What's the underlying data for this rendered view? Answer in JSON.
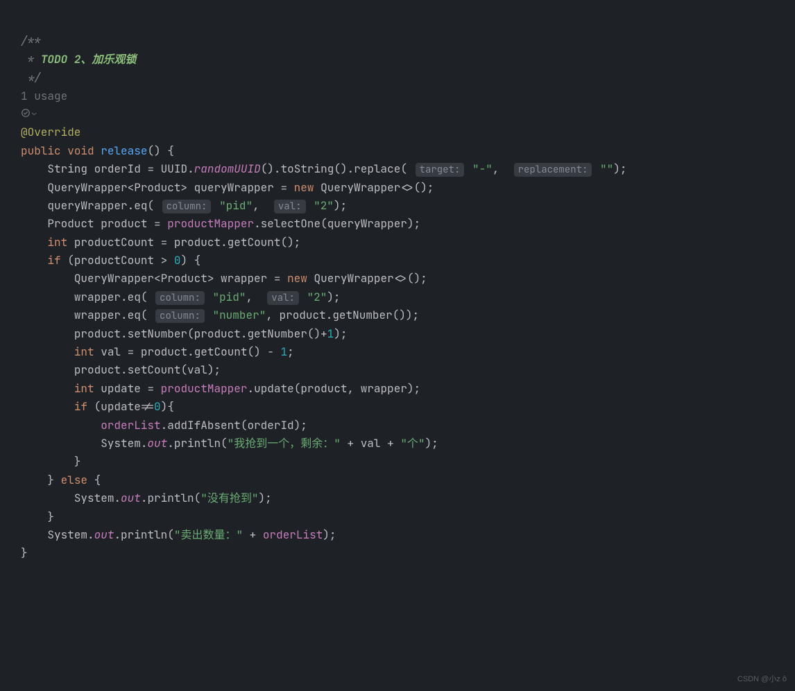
{
  "comment": {
    "open": "/**",
    "star": " * ",
    "todo": "TODO 2、加乐观锁",
    "close": " */"
  },
  "hints": {
    "usage": "1 usage",
    "target": "target:",
    "replacement": "replacement:",
    "column": "column:",
    "val": "val:"
  },
  "code": {
    "annotation": "@Override",
    "kw_public": "public",
    "kw_void": "void",
    "method_name": "release",
    "kw_new": "new",
    "kw_int": "int",
    "kw_if": "if",
    "kw_else": "else",
    "type_String": "String",
    "type_QueryWrapper": "QueryWrapper",
    "type_Product": "Product",
    "var_orderId": "orderId",
    "var_queryWrapper": "queryWrapper",
    "var_product": "product",
    "var_productCount": "productCount",
    "var_wrapper": "wrapper",
    "var_val": "val",
    "var_update": "update",
    "class_UUID": "UUID",
    "m_randomUUID": "randomUUID",
    "m_toString": "toString",
    "m_replace": "replace",
    "m_eq": "eq",
    "m_selectOne": "selectOne",
    "m_getCount": "getCount",
    "m_setCount": "setCount",
    "m_getNumber": "getNumber",
    "m_setNumber": "setNumber",
    "m_update": "update",
    "m_addIfAbsent": "addIfAbsent",
    "m_println": "println",
    "field_productMapper": "productMapper",
    "field_orderList": "orderList",
    "class_System": "System",
    "field_out": "out",
    "str_dash": "\"-\"",
    "str_empty": "\"\"",
    "str_pid": "\"pid\"",
    "str_2": "\"2\"",
    "str_number": "\"number\"",
    "str_grab": "\"我抢到一个，剩余：\"",
    "str_unit": "\"个\"",
    "str_fail": "\"没有抢到\"",
    "str_sold": "\"卖出数量：\"",
    "num_0": "0",
    "num_1": "1"
  },
  "watermark": "CSDN @小z ô"
}
